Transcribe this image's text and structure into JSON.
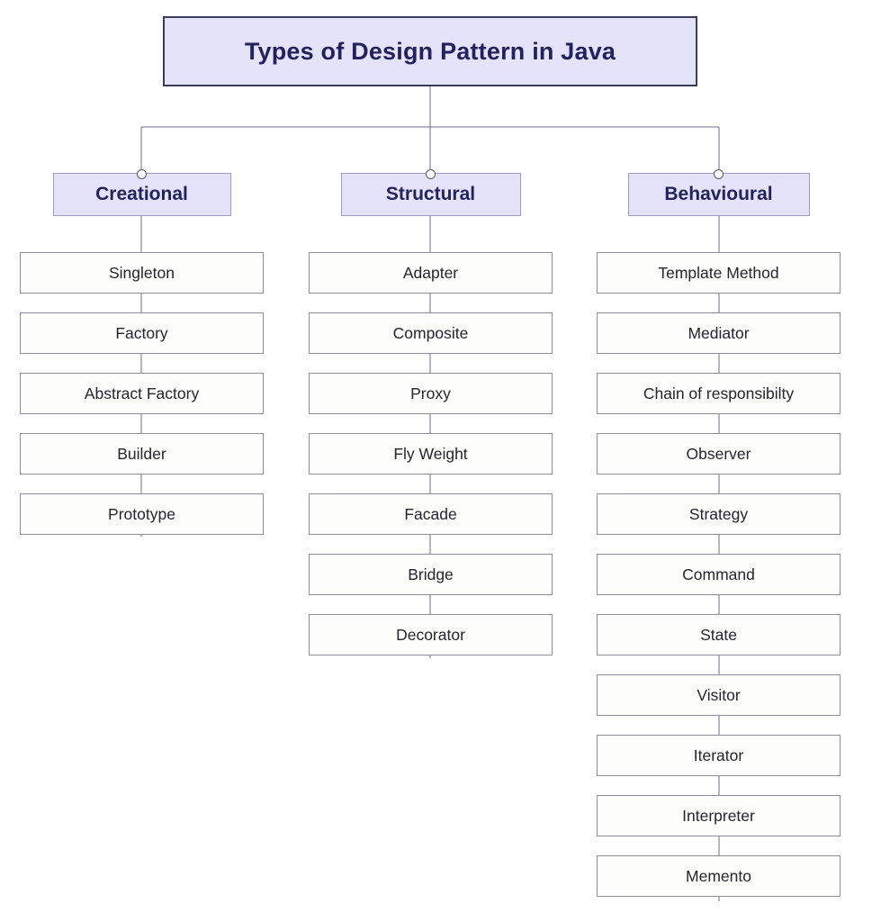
{
  "diagram": {
    "title": "Types of Design Pattern in Java",
    "colors": {
      "title_fill": "#e4e3fa",
      "title_border": "#3b3b5c",
      "title_text": "#23225e",
      "category_fill": "#e4e3fa",
      "category_border": "#9d9bc4",
      "category_text": "#23225e",
      "item_fill": "#fdfdfb",
      "item_border": "#8e8e98",
      "item_text": "#25252b",
      "connector": "#6e6e82",
      "background": "#ffffff"
    },
    "categories": [
      {
        "label": "Creational",
        "items": [
          "Singleton",
          "Factory",
          "Abstract Factory",
          "Builder",
          "Prototype"
        ]
      },
      {
        "label": "Structural",
        "items": [
          "Adapter",
          "Composite",
          "Proxy",
          "Fly Weight",
          "Facade",
          "Bridge",
          "Decorator"
        ]
      },
      {
        "label": "Behavioural",
        "items": [
          "Template Method",
          "Mediator",
          "Chain of responsibilty",
          "Observer",
          "Strategy",
          "Command",
          "State",
          "Visitor",
          "Iterator",
          "Interpreter",
          "Memento"
        ]
      }
    ]
  }
}
